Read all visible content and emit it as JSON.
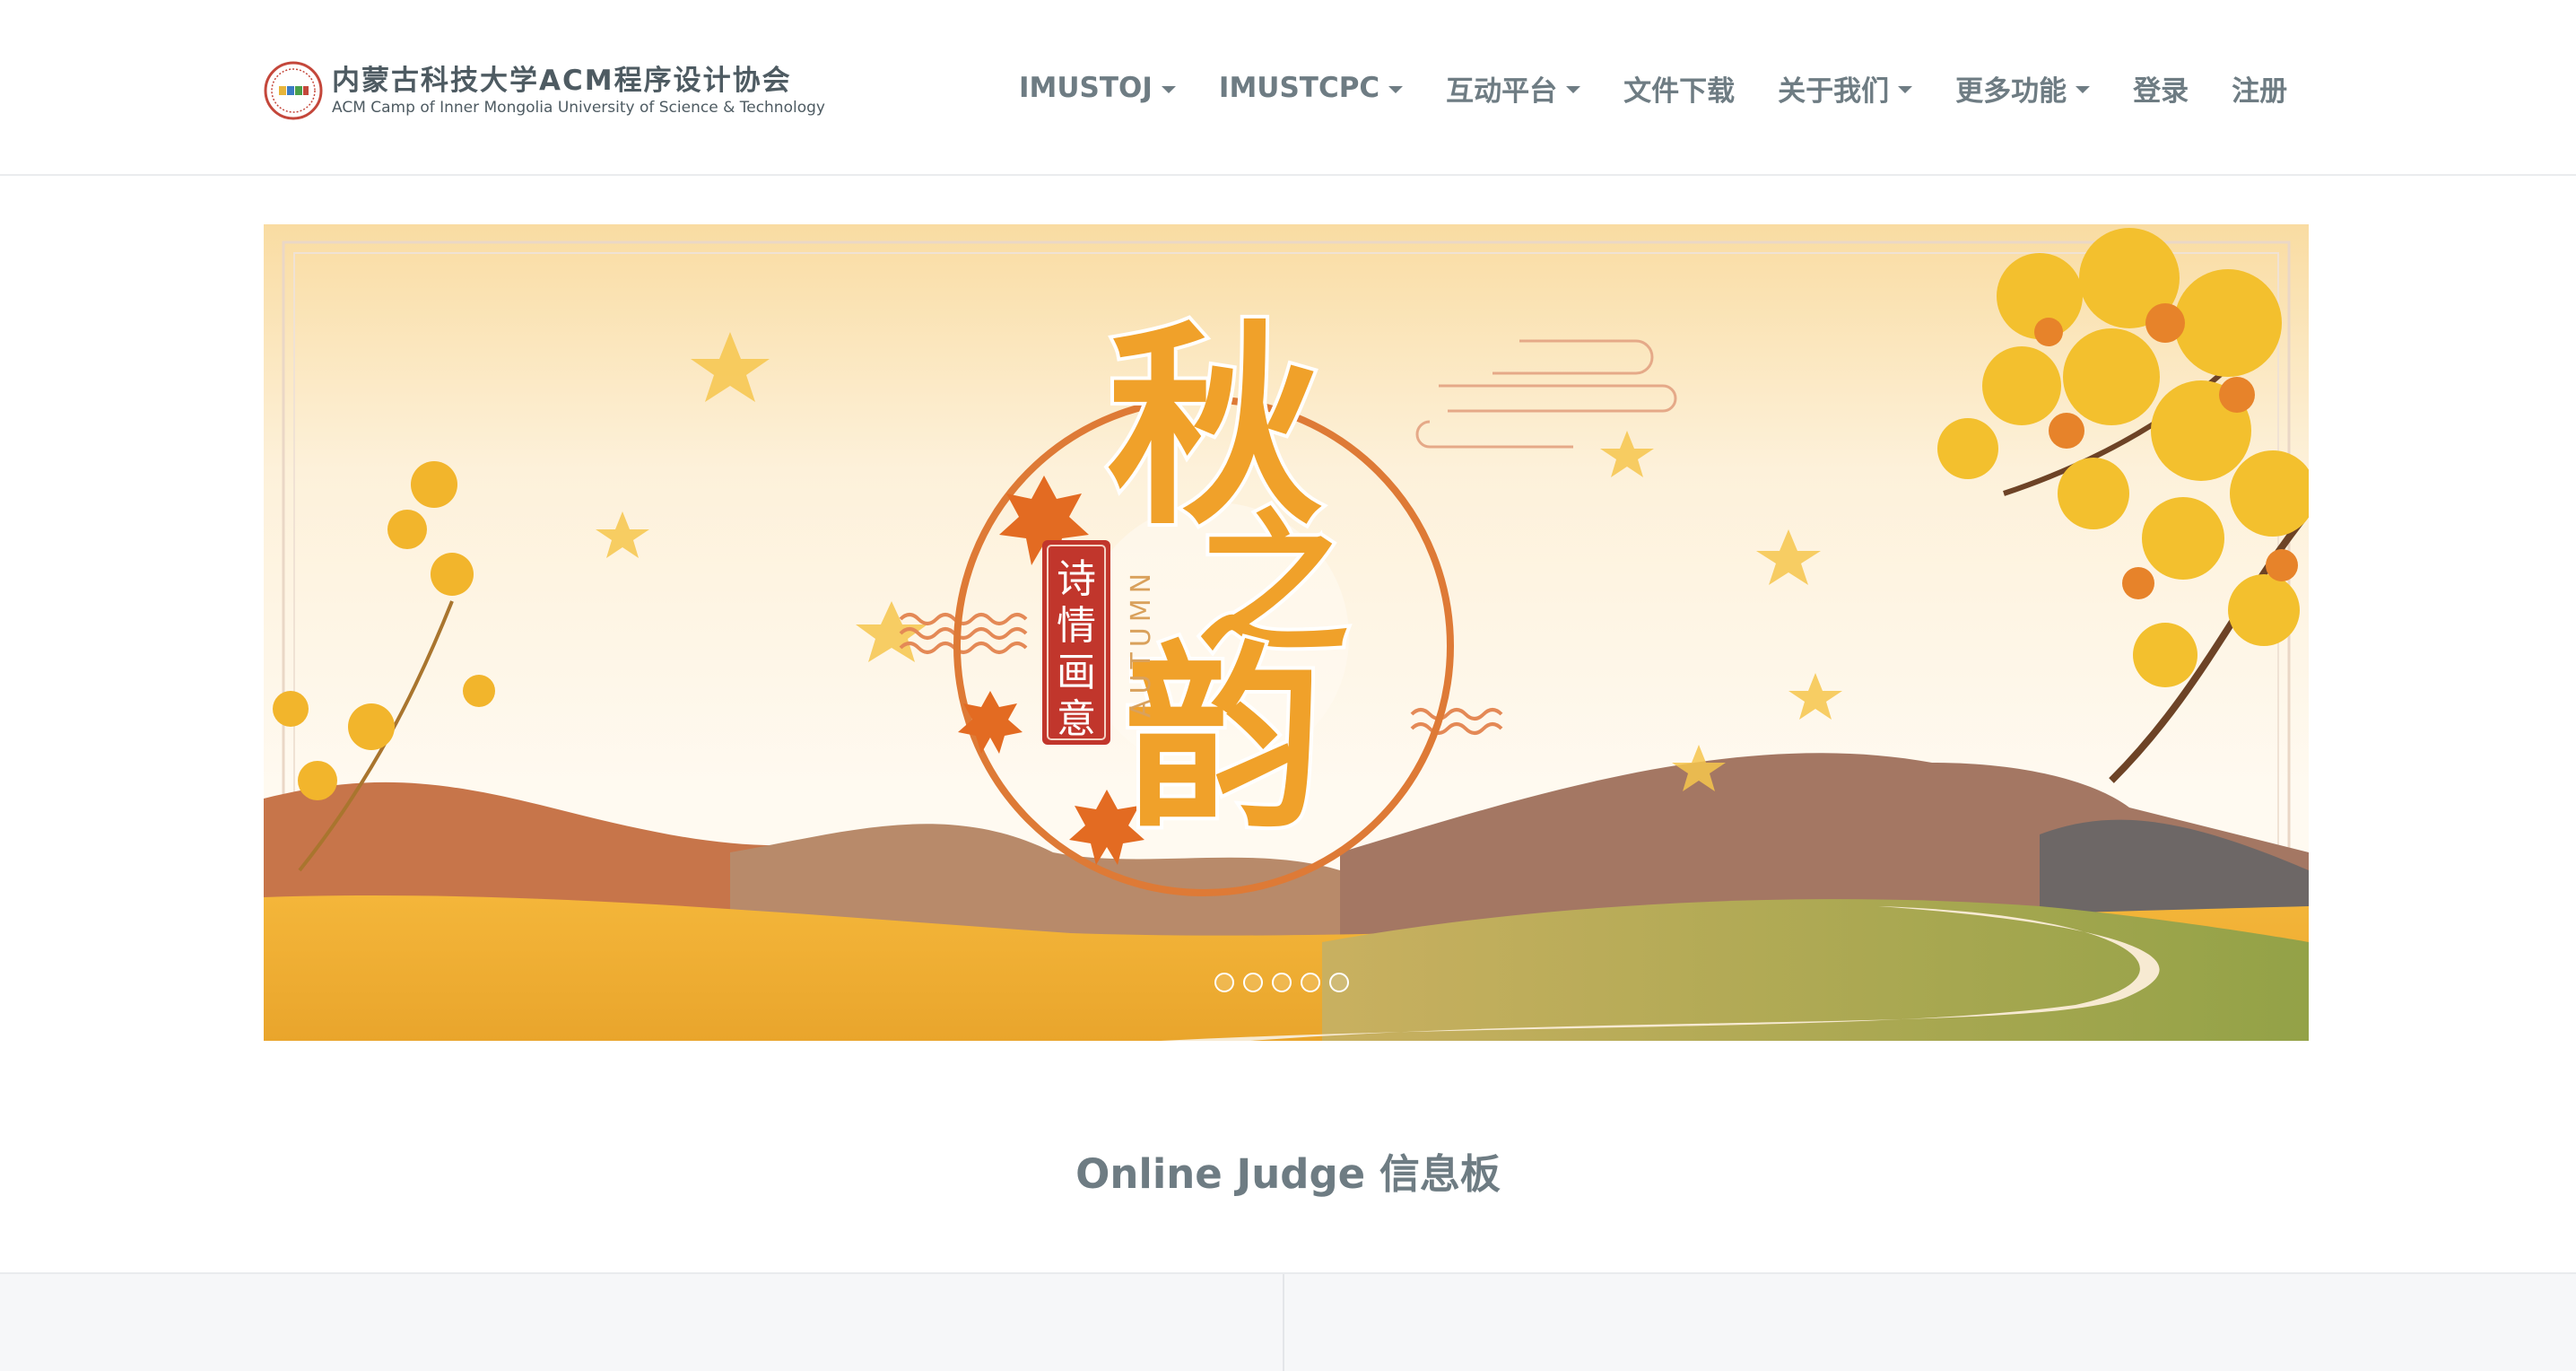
{
  "brand": {
    "title": "内蒙古科技大学ACM程序设计协会",
    "subtitle": "ACM Camp of Inner Mongolia University of Science & Technology"
  },
  "nav": [
    {
      "label": "IMUSTOJ",
      "dropdown": true
    },
    {
      "label": "IMUSTCPC",
      "dropdown": true
    },
    {
      "label": "互动平台",
      "dropdown": true
    },
    {
      "label": "文件下载",
      "dropdown": false
    },
    {
      "label": "关于我们",
      "dropdown": true
    },
    {
      "label": "更多功能",
      "dropdown": true
    },
    {
      "label": "登录",
      "dropdown": false
    },
    {
      "label": "注册",
      "dropdown": false
    }
  ],
  "banner": {
    "title_chars": [
      "秋",
      "之",
      "韵"
    ],
    "seal_chars": [
      "诗",
      "情",
      "画",
      "意"
    ],
    "vertical_text": "AUTUMN",
    "slide_count": 5,
    "active_slide": 1
  },
  "board": {
    "title": "Online Judge 信息板"
  },
  "colors": {
    "nav_text": "#6e7c83",
    "brand_text": "#4e5b62",
    "seal_red": "#c1362c",
    "title_orange": "#f0a12a"
  }
}
